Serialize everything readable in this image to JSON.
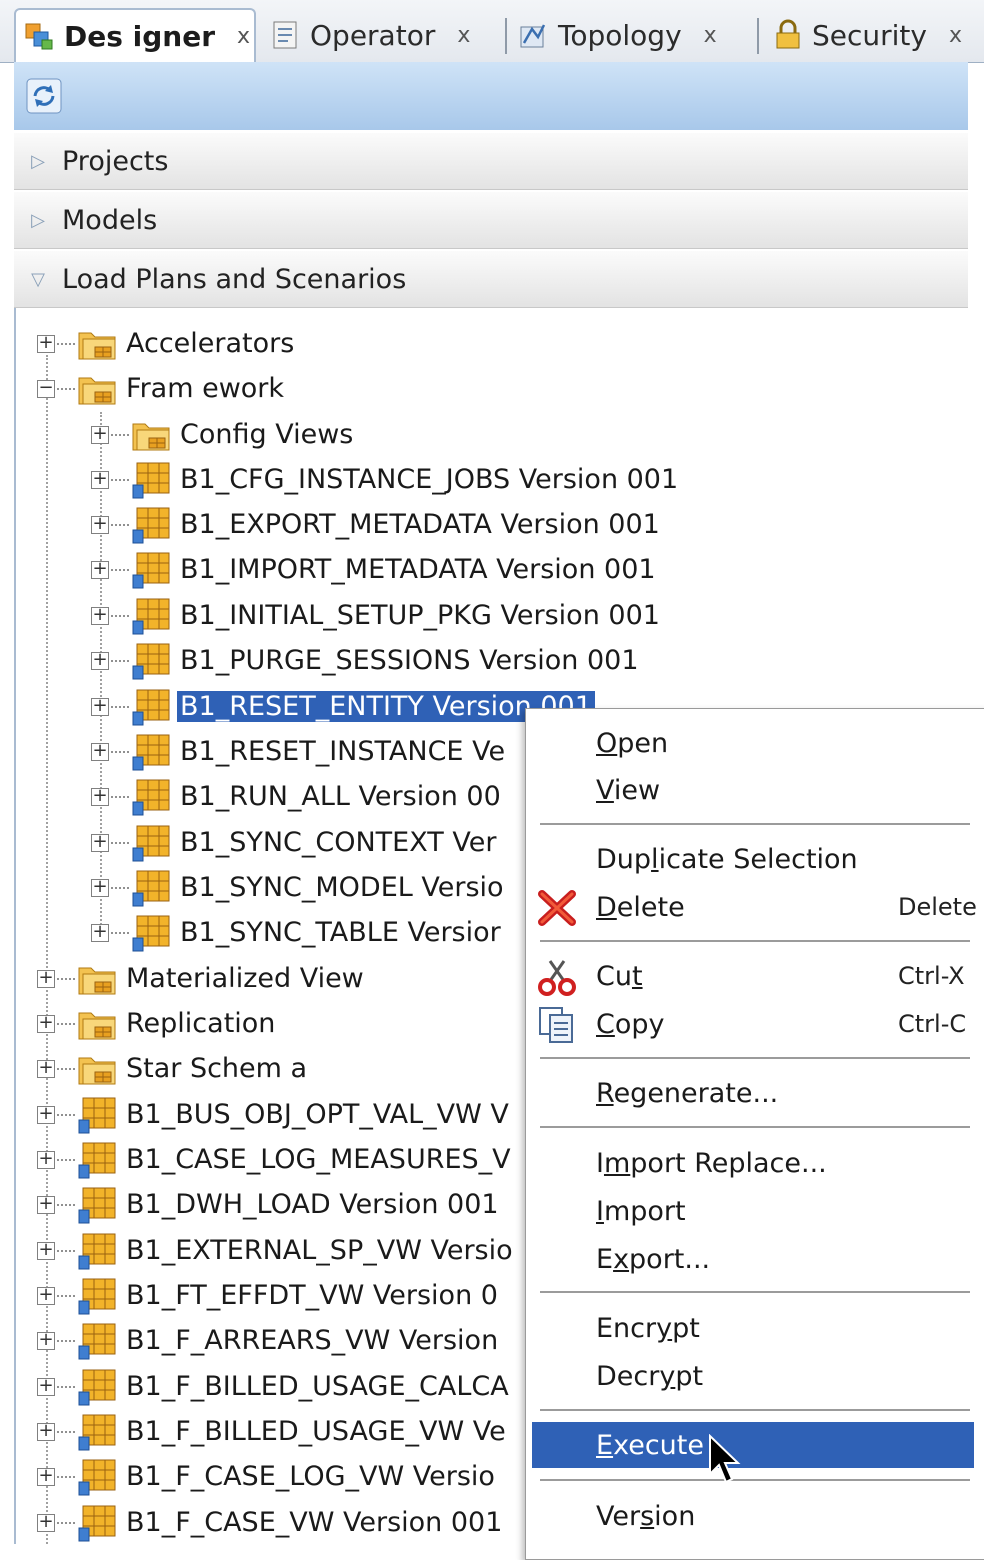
{
  "tabs": [
    {
      "label": "Des igner",
      "close": "x",
      "active": true
    },
    {
      "label": "Operator",
      "close": "x",
      "active": false
    },
    {
      "label": "Topology",
      "close": "x",
      "active": false
    },
    {
      "label": "Security",
      "close": "x",
      "active": false
    }
  ],
  "accordion": {
    "projects": "Projects",
    "models": "Models",
    "load_plans": "Load Plans and Scenarios"
  },
  "tree": {
    "accelerators": "Accelerators",
    "framework": "Fram ework",
    "config_views": "Config Views",
    "b1_cfg_instance_jobs": "B1_CFG_INSTANCE_JOBS Version 001",
    "b1_export_metadata": "B1_EXPORT_METADATA Version 001",
    "b1_import_metadata": "B1_IMPORT_METADATA Version 001",
    "b1_initial_setup_pkg": "B1_INITIAL_SETUP_PKG Version 001",
    "b1_purge_sessions": "B1_PURGE_SESSIONS Version 001",
    "b1_reset_entity": "B1_RESET_ENTITY Version 001",
    "b1_reset_instance": "B1_RESET_INSTANCE Ve",
    "b1_run_all": "B1_RUN_ALL Version 00",
    "b1_sync_context": "B1_SYNC_CONTEXT Ver",
    "b1_sync_model": "B1_SYNC_MODEL Versio",
    "b1_sync_table": "B1_SYNC_TABLE Versior",
    "materialized_view": "Materialized View",
    "replication": "Replication",
    "star_schema": "Star Schem a",
    "b1_bus_obj_opt_val_vw": "B1_BUS_OBJ_OPT_VAL_VW V",
    "b1_case_log_measures": "B1_CASE_LOG_MEASURES_V",
    "b1_dwh_load": "B1_DWH_LOAD Version 001",
    "b1_external_sp_vw": "B1_EXTERNAL_SP_VW Versio",
    "b1_ft_effdt_vw": "B1_FT_EFFDT_VW Version 0",
    "b1_f_arrears_vw": "B1_F_ARREARS_VW Version",
    "b1_f_billed_usage_calc": "B1_F_BILLED_USAGE_CALCA",
    "b1_f_billed_usage_vw": "B1_F_BILLED_USAGE_VW Ve",
    "b1_f_case_log_vw": "B1_F_CASE_LOG_VW Versio",
    "b1_f_case_vw": "B1_F_CASE_VW Version 001"
  },
  "menu": {
    "open": {
      "pre": "",
      "u": "O",
      "post": "pen"
    },
    "view": {
      "pre": "",
      "u": "V",
      "post": "iew"
    },
    "duplicate": {
      "pre": "Dup",
      "u": "l",
      "post": "icate Selection"
    },
    "delete": {
      "pre": "",
      "u": "D",
      "post": "elete",
      "shortcut": "Delete"
    },
    "cut": {
      "pre": "Cu",
      "u": "t",
      "post": "",
      "shortcut": "Ctrl-X"
    },
    "copy": {
      "pre": "",
      "u": "C",
      "post": "opy",
      "shortcut": "Ctrl-C"
    },
    "regenerate": {
      "pre": "",
      "u": "R",
      "post": "egenerate..."
    },
    "import_replace": {
      "pre": "I",
      "u": "m",
      "post": "port Replace..."
    },
    "import": {
      "pre": "",
      "u": "I",
      "post": "mport"
    },
    "export": {
      "pre": "E",
      "u": "x",
      "post": "port..."
    },
    "encrypt": {
      "pre": "Encr",
      "u": "y",
      "post": "pt"
    },
    "decrypt": {
      "pre": "Decr",
      "u": "y",
      "post": "pt"
    },
    "execute": {
      "pre": "",
      "u": "E",
      "post": "xecute"
    },
    "version": {
      "pre": "Ver",
      "u": "s",
      "post": "ion"
    }
  }
}
